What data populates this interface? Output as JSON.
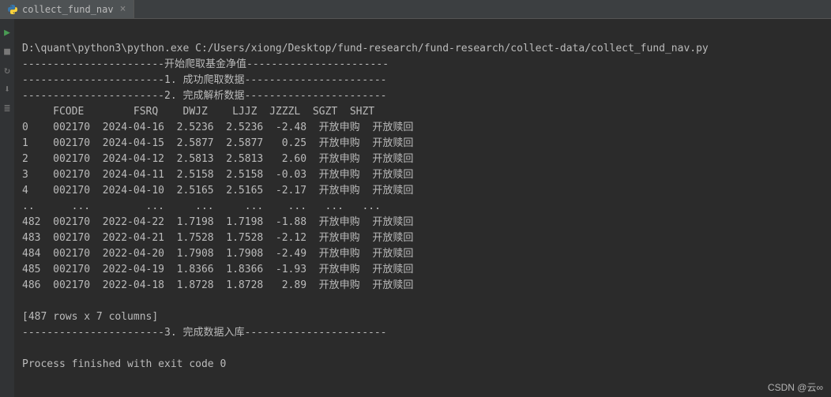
{
  "tab": {
    "label": "collect_fund_nav",
    "close": "×"
  },
  "gutter": {
    "run": "▶",
    "stop": "■",
    "rerun": "↻",
    "debug": "⬇",
    "settings": "≣"
  },
  "console": {
    "command": "D:\\quant\\python3\\python.exe C:/Users/xiong/Desktop/fund-research/fund-research/collect-data/collect_fund_nav.py",
    "sep_start": "-----------------------开始爬取基金净值-----------------------",
    "sep_1": "-----------------------1. 成功爬取数据-----------------------",
    "sep_2": "-----------------------2. 完成解析数据-----------------------",
    "header": "     FCODE        FSRQ    DWJZ    LJJZ  JZZZL  SGZT  SHZT",
    "chart_data": {
      "type": "table",
      "columns": [
        "index",
        "FCODE",
        "FSRQ",
        "DWJZ",
        "LJJZ",
        "JZZZL",
        "SGZT",
        "SHZT"
      ],
      "rows_top": [
        [
          "0",
          "002170",
          "2024-04-16",
          "2.5236",
          "2.5236",
          "-2.48",
          "开放申购",
          "开放赎回"
        ],
        [
          "1",
          "002170",
          "2024-04-15",
          "2.5877",
          "2.5877",
          "0.25",
          "开放申购",
          "开放赎回"
        ],
        [
          "2",
          "002170",
          "2024-04-12",
          "2.5813",
          "2.5813",
          "2.60",
          "开放申购",
          "开放赎回"
        ],
        [
          "3",
          "002170",
          "2024-04-11",
          "2.5158",
          "2.5158",
          "-0.03",
          "开放申购",
          "开放赎回"
        ],
        [
          "4",
          "002170",
          "2024-04-10",
          "2.5165",
          "2.5165",
          "-2.17",
          "开放申购",
          "开放赎回"
        ]
      ],
      "rows_bottom": [
        [
          "482",
          "002170",
          "2022-04-22",
          "1.7198",
          "1.7198",
          "-1.88",
          "开放申购",
          "开放赎回"
        ],
        [
          "483",
          "002170",
          "2022-04-21",
          "1.7528",
          "1.7528",
          "-2.12",
          "开放申购",
          "开放赎回"
        ],
        [
          "484",
          "002170",
          "2022-04-20",
          "1.7908",
          "1.7908",
          "-2.49",
          "开放申购",
          "开放赎回"
        ],
        [
          "485",
          "002170",
          "2022-04-19",
          "1.8366",
          "1.8366",
          "-1.93",
          "开放申购",
          "开放赎回"
        ],
        [
          "486",
          "002170",
          "2022-04-18",
          "1.8728",
          "1.8728",
          "2.89",
          "开放申购",
          "开放赎回"
        ]
      ]
    },
    "row0": "0    002170  2024-04-16  2.5236  2.5236  -2.48  开放申购  开放赎回",
    "row1": "1    002170  2024-04-15  2.5877  2.5877   0.25  开放申购  开放赎回",
    "row2": "2    002170  2024-04-12  2.5813  2.5813   2.60  开放申购  开放赎回",
    "row3": "3    002170  2024-04-11  2.5158  2.5158  -0.03  开放申购  开放赎回",
    "row4": "4    002170  2024-04-10  2.5165  2.5165  -2.17  开放申购  开放赎回",
    "ellipsis": "..      ...         ...     ...     ...    ...   ...   ...",
    "row482": "482  002170  2022-04-22  1.7198  1.7198  -1.88  开放申购  开放赎回",
    "row483": "483  002170  2022-04-21  1.7528  1.7528  -2.12  开放申购  开放赎回",
    "row484": "484  002170  2022-04-20  1.7908  1.7908  -2.49  开放申购  开放赎回",
    "row485": "485  002170  2022-04-19  1.8366  1.8366  -1.93  开放申购  开放赎回",
    "row486": "486  002170  2022-04-18  1.8728  1.8728   2.89  开放申购  开放赎回",
    "blank": "",
    "summary": "[487 rows x 7 columns]",
    "sep_3": "-----------------------3. 完成数据入库-----------------------",
    "finished": "Process finished with exit code 0"
  },
  "watermark": "CSDN @云∞"
}
